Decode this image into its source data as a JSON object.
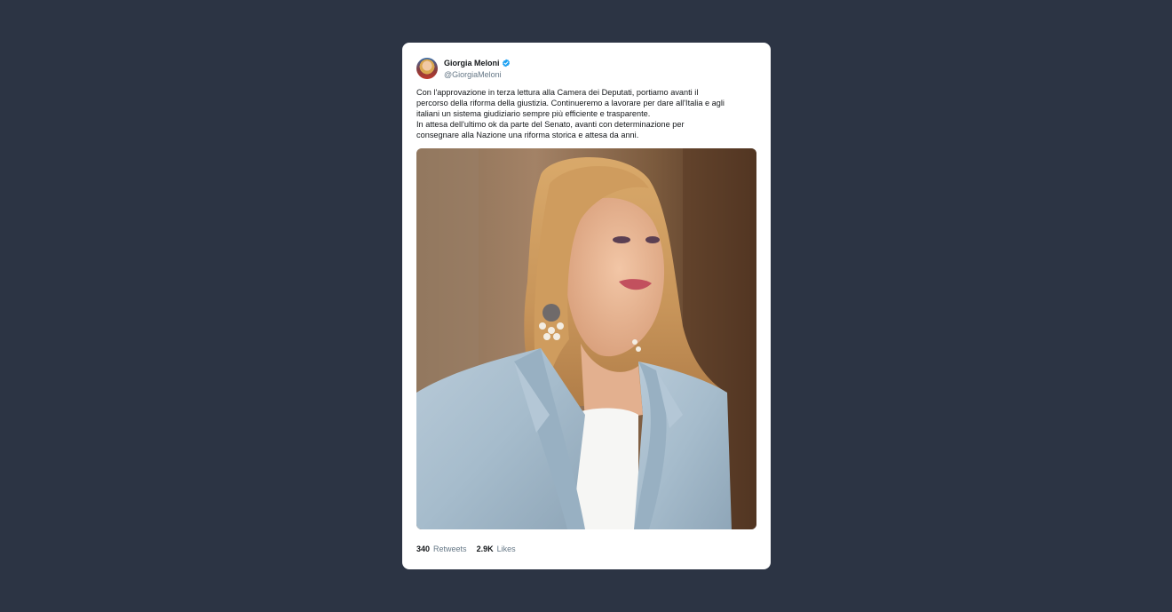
{
  "tweet": {
    "display_name": "Giorgia Meloni",
    "handle": "@GiorgiaMeloni",
    "verified": true,
    "text": "Con l'approvazione in terza lettura alla Camera dei Deputati, portiamo avanti il\npercorso della riforma della giustizia. Continueremo a lavorare per dare all'Italia e agli\nitaliani un sistema giudiziario sempre più efficiente e trasparente.\nIn attesa dell'ultimo ok da parte del Senato, avanti con determinazione per\nconsegnare alla Nazione una riforma storica e attesa da anni.",
    "icons": {
      "avatar": "avatar-photo",
      "verified": "verified-badge-icon"
    },
    "stats": {
      "retweets_count": "340",
      "retweets_label": "Retweets",
      "likes_count": "2.9K",
      "likes_label": "Likes"
    }
  },
  "colors": {
    "page_background": "#2c3444",
    "card_background": "#ffffff",
    "verified_blue": "#1da1f2",
    "secondary_text": "#657786",
    "primary_text": "#14171a"
  }
}
